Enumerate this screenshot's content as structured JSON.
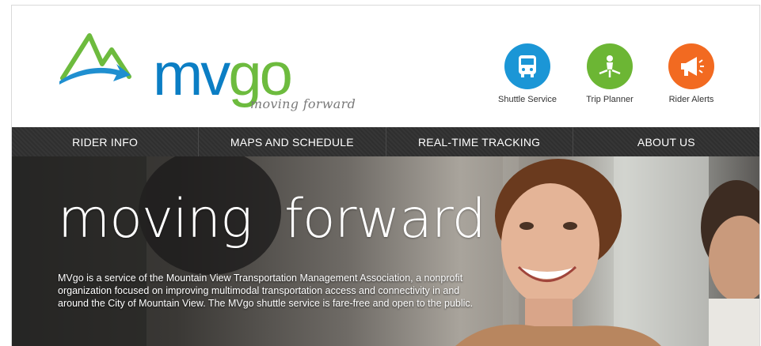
{
  "brand": {
    "wordmark_mv": "mv",
    "wordmark_go": "go",
    "tagline": "moving forward",
    "colors": {
      "blue": "#0b7ec4",
      "green": "#6dbb3e",
      "orange": "#f26a21",
      "nav": "#2f2f2f"
    }
  },
  "quick_links": [
    {
      "label": "Shuttle Service",
      "icon": "bus-icon",
      "color": "#1b96d6"
    },
    {
      "label": "Trip Planner",
      "icon": "trip-planner-icon",
      "color": "#6cb634"
    },
    {
      "label": "Rider Alerts",
      "icon": "megaphone-icon",
      "color": "#f26a21"
    }
  ],
  "nav": {
    "items": [
      {
        "label": "RIDER INFO"
      },
      {
        "label": "MAPS AND SCHEDULE"
      },
      {
        "label": "REAL-TIME TRACKING"
      },
      {
        "label": "ABOUT US"
      }
    ]
  },
  "hero": {
    "title": "moving  forward",
    "description": "MVgo is a service of the Mountain View Transportation Management Association, a nonprofit organization focused on improving multimodal transportation access and connectivity in and around the City of Mountain View. The MVgo shuttle service is fare-free and open to the public."
  }
}
